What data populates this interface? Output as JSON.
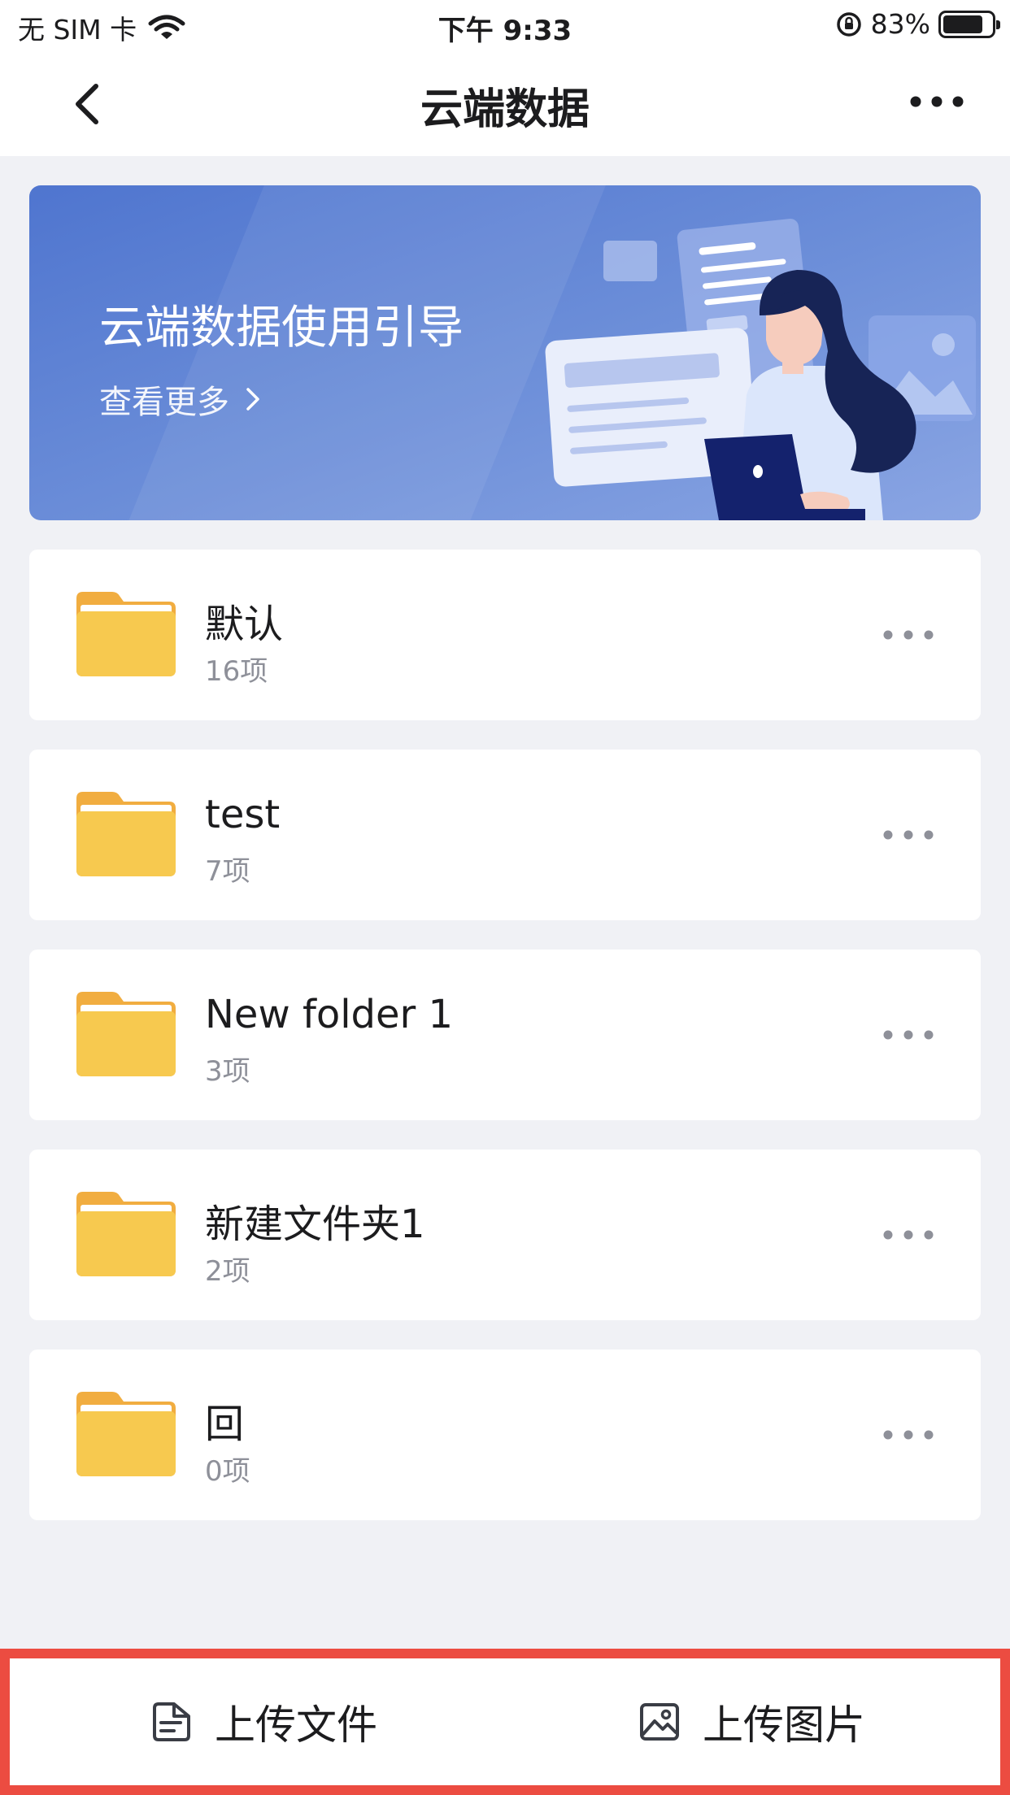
{
  "status_bar": {
    "carrier": "无 SIM 卡",
    "time": "下午 9:33",
    "battery": "83%",
    "battery_level": 0.83
  },
  "nav": {
    "title": "云端数据",
    "back_icon": "chevron-left-icon",
    "more_icon": "more-horizontal-icon"
  },
  "banner": {
    "title": "云端数据使用引导",
    "more_label": "查看更多"
  },
  "folders": [
    {
      "name": "默认",
      "count": "16项"
    },
    {
      "name": "test",
      "count": "7项"
    },
    {
      "name": "New folder 1",
      "count": "3项"
    },
    {
      "name": "新建文件夹1",
      "count": "2项"
    },
    {
      "name": "回",
      "count": "0项"
    }
  ],
  "bottom_bar": {
    "upload_file": "上传文件",
    "upload_image": "上传图片"
  },
  "colors": {
    "accent_border": "#ec4c41",
    "folder": "#f7c94f",
    "banner": "#5a7ed3"
  }
}
